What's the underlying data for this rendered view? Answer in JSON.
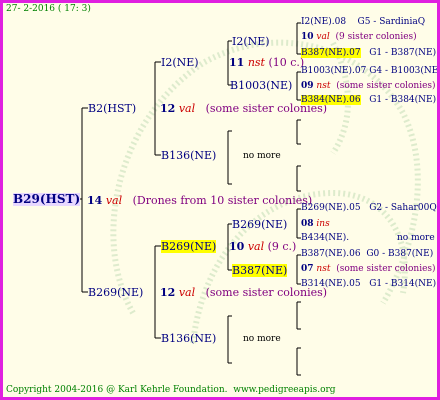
{
  "header": {
    "date": "27- 2-2016 ( 17: 3)"
  },
  "footer": {
    "copyright": "Copyright 2004-2016 @ Karl Kehrle Foundation.",
    "site": "www.pedigreeapis.org"
  },
  "colors": {
    "border": "#e020e0",
    "background": "#fffde8",
    "text": "#000080",
    "highlight": "#ffff00",
    "accent": "#cc0000",
    "note": "#800080",
    "header": "#008000"
  },
  "root": {
    "name": "B29(HST)",
    "gen": "14",
    "mark": "val",
    "note": "(Drones from 10 sister colonies)"
  },
  "gen1": [
    {
      "name": "B2(HST)",
      "gen": "12",
      "mark": "val",
      "note": "(some sister colonies)"
    },
    {
      "name": "B269(NE)",
      "gen": "12",
      "mark": "val",
      "note": "(some sister colonies)"
    }
  ],
  "gen2": [
    {
      "name": "I2(NE)",
      "gen": "11",
      "mark": "nst",
      "note": "(10 c.)"
    },
    {
      "name": "B136(NE)",
      "nomore": "no more"
    },
    {
      "name": "B269(NE)",
      "gen": "10",
      "mark": "val",
      "note": "(9 c.)"
    },
    {
      "name": "B136(NE)",
      "nomore": "no more"
    }
  ],
  "gen3": [
    {
      "name": "I2(NE)"
    },
    {
      "name": "B1003(NE)"
    },
    {
      "name": "B269(NE)",
      "gen": "08",
      "mark": "ins"
    },
    {
      "name": "B387(NE)"
    }
  ],
  "gen4": [
    {
      "name": "I2(NE)",
      "num": ".08",
      "ref": "G5 - SardiniaQ"
    },
    {
      "num": "10",
      "mark": "val",
      "note": "(9 sister colonies)"
    },
    {
      "name": "B387(NE)",
      "num": ".07",
      "ref": "G1 - B387(NE)"
    },
    {
      "name": "B1003(NE)",
      "num": ".07",
      "ref": "G4 - B1003(NE)"
    },
    {
      "num": "09",
      "mark": "nst",
      "note": "(some sister colonies)"
    },
    {
      "name": "B384(NE)",
      "num": ".06",
      "ref": "G1 - B384(NE)"
    },
    {
      "name": "B269(NE)",
      "num": ".05",
      "ref": "G2 - Sahar00Q"
    },
    {
      "name": "B434(NE)",
      "num": ".",
      "ref": "no more"
    },
    {
      "name": "B387(NE)",
      "num": ".06",
      "ref": "G0 - B387(NE)"
    },
    {
      "num": "07",
      "mark": "nst",
      "note": "(some sister colonies)"
    },
    {
      "name": "B314(NE)",
      "num": ".05",
      "ref": "G1 - B314(NE)"
    }
  ]
}
